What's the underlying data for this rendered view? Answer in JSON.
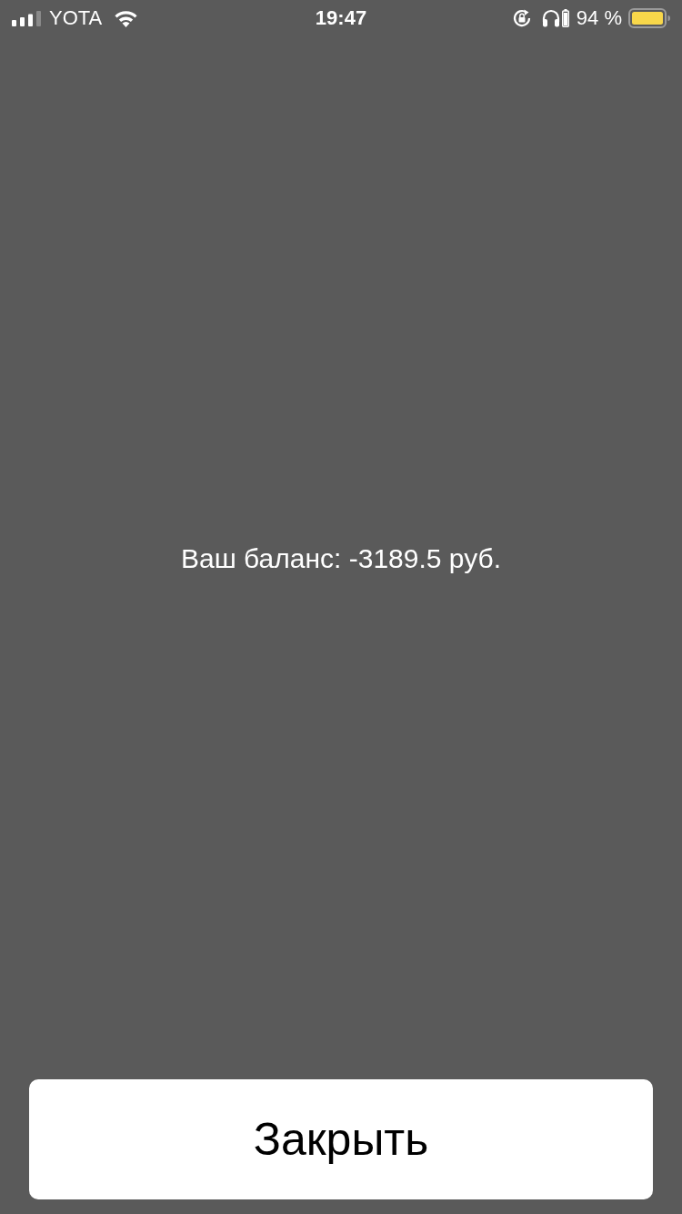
{
  "status_bar": {
    "carrier": "YOTA",
    "time": "19:47",
    "battery_percent": "94 %"
  },
  "balance": {
    "text": "Ваш баланс: -3189.5 руб."
  },
  "close_button": {
    "label": "Закрыть"
  }
}
